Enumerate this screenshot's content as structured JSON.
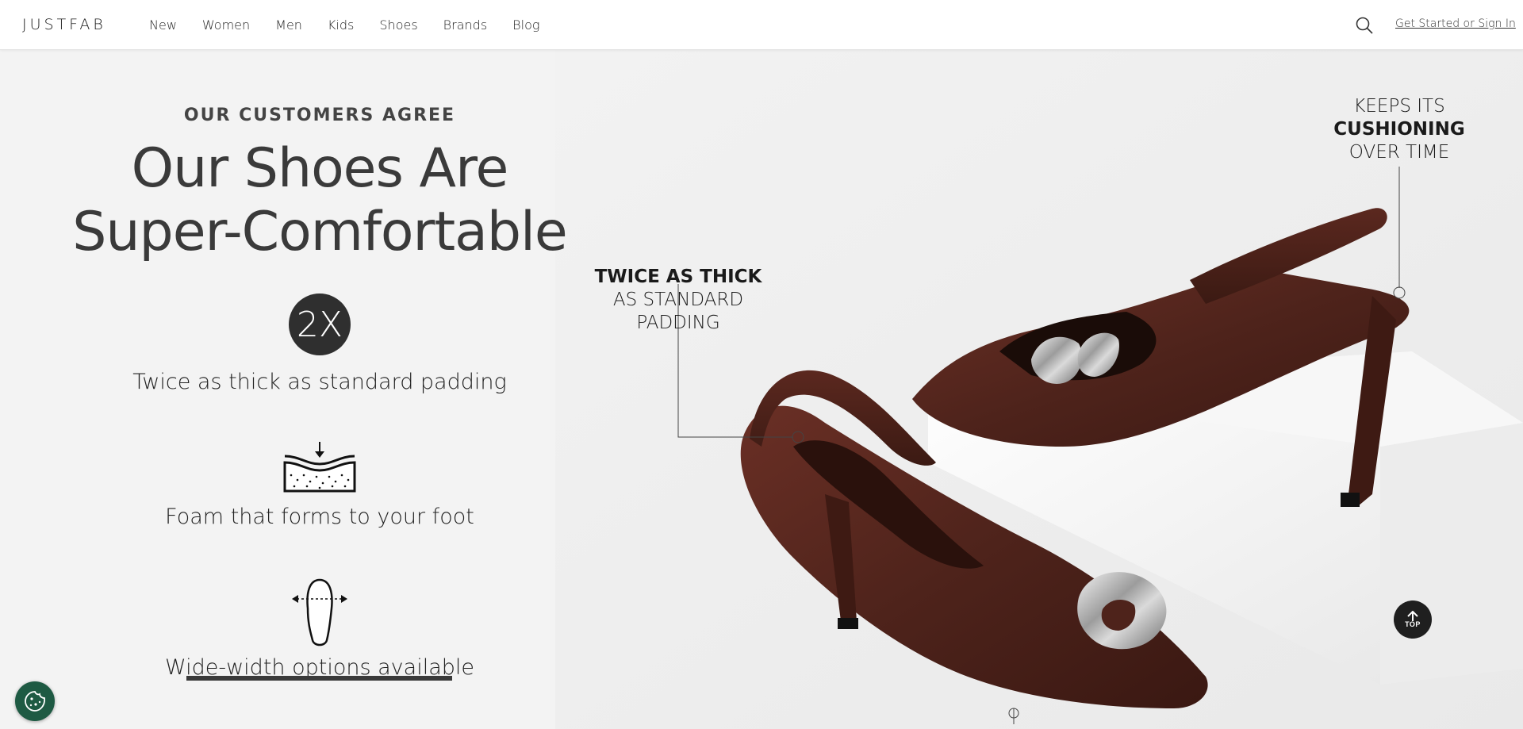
{
  "header": {
    "logo": "JUSTFAB",
    "nav": [
      "New",
      "Women",
      "Men",
      "Kids",
      "Shoes",
      "Brands",
      "Blog"
    ],
    "signin": "Get Started or Sign In",
    "search_icon": "search-icon"
  },
  "hero": {
    "eyebrow": "OUR CUSTOMERS AGREE",
    "headline_line1": "Our Shoes Are",
    "headline_line2": "Super-Comfortable",
    "features": [
      {
        "icon": "2x-badge",
        "badge": "2X",
        "label": "Twice as thick as standard padding"
      },
      {
        "icon": "foam-icon",
        "label": "Foam that forms to your foot"
      },
      {
        "icon": "wide-width-icon",
        "label": "Wide-width options available"
      }
    ],
    "callout_left": {
      "bold": "TWICE AS THICK",
      "line2": "AS STANDARD",
      "line3": "PADDING"
    },
    "callout_right": {
      "line1": "KEEPS ITS",
      "bold": "CUSHIONING",
      "line3": "OVER TIME"
    }
  },
  "floating": {
    "top_label": "TOP",
    "cookie_icon": "cookie-icon"
  },
  "colors": {
    "shoe": "#4e231b",
    "badge": "#2f2f2f",
    "cookie": "#1e5a43"
  }
}
